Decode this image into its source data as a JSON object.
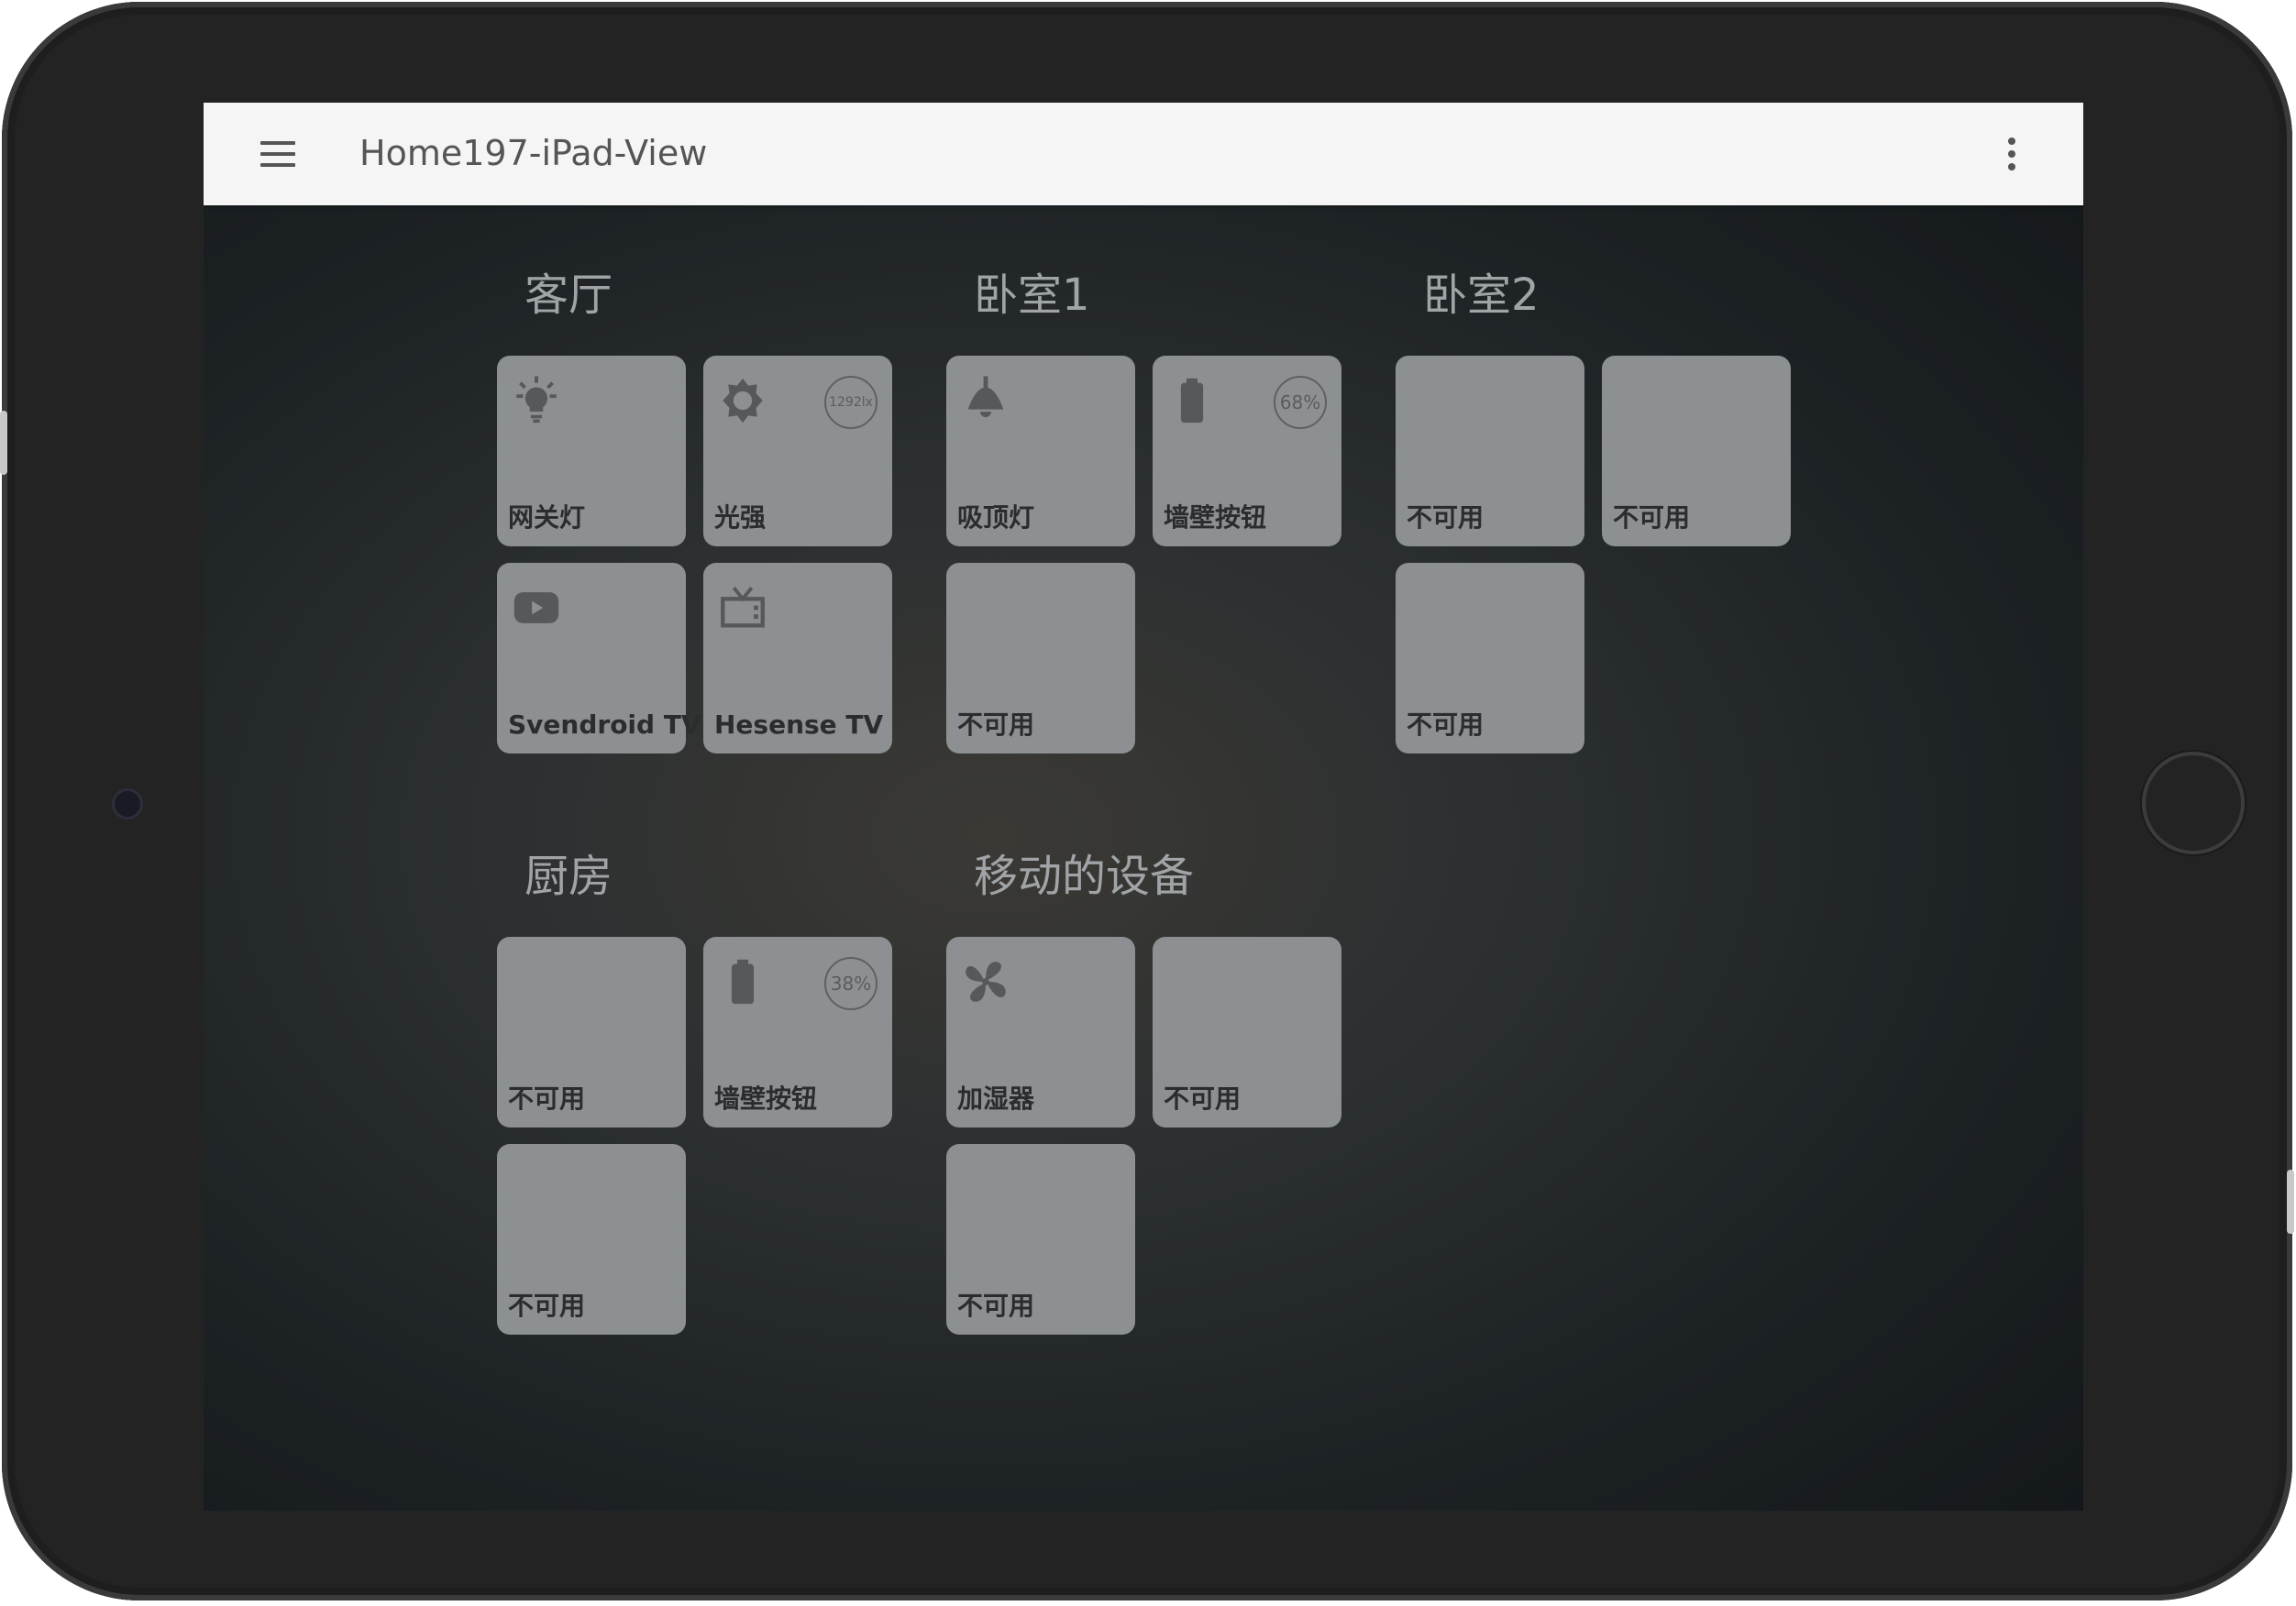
{
  "appbar": {
    "title": "Home197-iPad-View"
  },
  "groups": [
    {
      "title": "客厅"
    },
    {
      "title": "卧室1"
    },
    {
      "title": "卧室2"
    },
    {
      "title": "厨房"
    },
    {
      "title": "移动的设备"
    }
  ],
  "tiles": {
    "living_light": {
      "label": "网关灯",
      "icon": "lightbulb-icon"
    },
    "living_illuminance": {
      "label": "光强",
      "icon": "brightness-icon",
      "badge": "1292lx"
    },
    "living_svendroid": {
      "label": "Svendroid TV",
      "icon": "play-video-icon"
    },
    "living_hesense": {
      "label": "Hesense TV",
      "icon": "tv-icon"
    },
    "bed1_ceiling": {
      "label": "吸顶灯",
      "icon": "ceiling-lamp-icon"
    },
    "bed1_wall_switch": {
      "label": "墙壁按钮",
      "icon": "battery-icon",
      "badge": "68%"
    },
    "bed1_unavailable": {
      "label": "不可用"
    },
    "bed2_unavailable_1": {
      "label": "不可用"
    },
    "bed2_unavailable_2": {
      "label": "不可用"
    },
    "bed2_unavailable_3": {
      "label": "不可用"
    },
    "kitchen_unavailable_1": {
      "label": "不可用"
    },
    "kitchen_wall_switch": {
      "label": "墙壁按钮",
      "icon": "battery-icon",
      "badge": "38%"
    },
    "kitchen_unavailable_2": {
      "label": "不可用"
    },
    "mobile_humidifier": {
      "label": "加湿器",
      "icon": "fan-icon"
    },
    "mobile_unavailable_1": {
      "label": "不可用"
    },
    "mobile_unavailable_2": {
      "label": "不可用"
    }
  },
  "colors": {
    "tile": "#8d9092",
    "appbar": "#f5f5f5",
    "group_title": "#a0a4a6"
  }
}
